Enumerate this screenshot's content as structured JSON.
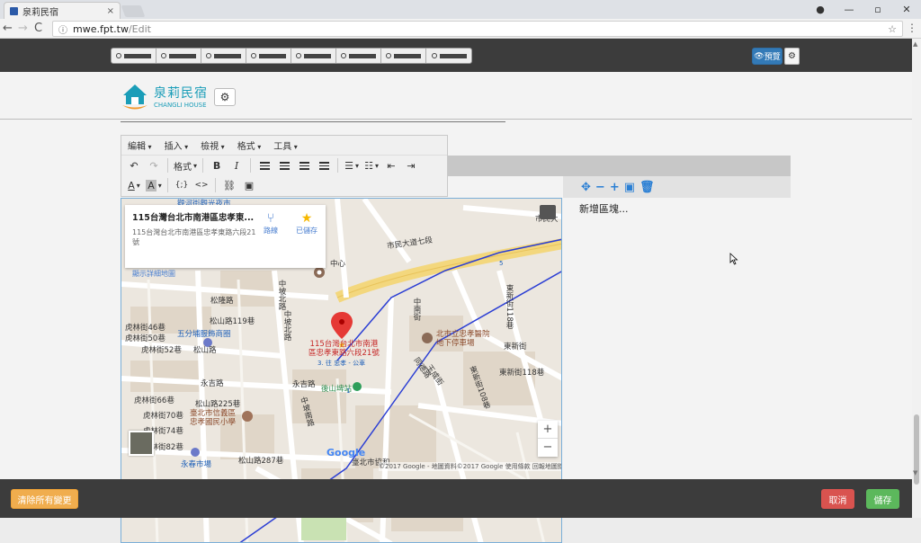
{
  "browser": {
    "tab_title": "泉莉民宿",
    "tab_close": "×",
    "url_host": "mwe.fpt.tw",
    "url_path": "/Edit",
    "nav_back": "←",
    "nav_forward": "→",
    "nav_reload": "C",
    "info_icon": "ⓘ",
    "star_icon": "☆",
    "menu_icon": "⋮",
    "window": {
      "account": "●",
      "minimize": "—",
      "restore": "▫",
      "close": "✕"
    }
  },
  "topbar": {
    "preview_label": "預覽",
    "segment_count": 8
  },
  "logo": {
    "name_cn": "泉莉民宿",
    "name_en": "CHANGLI HOUSE",
    "brand_color": "#1a9db8"
  },
  "editor": {
    "menu": [
      "編輯",
      "插入",
      "檢視",
      "格式",
      "工具"
    ],
    "format_label": "格式",
    "bold": "B",
    "italic": "I",
    "code_block": "{;}",
    "source": "<>",
    "undo": "↶",
    "redo": "↷",
    "font_color": "A",
    "bg_color": "A",
    "link": "⛓",
    "image": "▣"
  },
  "right_panel": {
    "add_block": "新增區塊...",
    "icons": [
      "move-icon",
      "minus-icon",
      "plus-icon",
      "image-icon",
      "trash-icon"
    ]
  },
  "map": {
    "info": {
      "title": "115台灣台北市南港區忠孝東...",
      "address": "115台灣台北市南港區忠孝東路六段21號",
      "route": "路線",
      "saved": "已儲存",
      "more": "顯示詳細地圖"
    },
    "top_label": "觀河街觀光夜市",
    "marker_label_1": "115台灣台北市南港",
    "marker_label_2": "區忠孝東路六段21號",
    "google": "Google",
    "attribution": "©2017 Google - 地圖資料©2017 Google   使用條款   回報地圖錯誤",
    "zoom_in": "+",
    "zoom_out": "−",
    "labels": {
      "songlong": "松隆路",
      "songshan119": "松山路119巷",
      "hulin46": "虎林街46巷",
      "hulin50": "虎林街50巷",
      "hulin52": "虎林街52巷",
      "wufen": "五分埔服飾商圈",
      "songshan": "松山路",
      "yongji": "永吉路",
      "yongji2": "永吉路",
      "hulin66": "虎林街66巷",
      "hulin70": "虎林街70巷",
      "hulin74": "虎林街74巷",
      "hulin82": "虎林街82巷",
      "songshan225": "松山路225巷",
      "xinyi_school": "臺北市信義區\n忠孝國民小學",
      "yongchun_market": "永春市場",
      "songshan287": "松山路287巷",
      "yongchun_station": "後山埤站",
      "shimin7": "市民大道七段",
      "zhongxin": "中心",
      "zhongpo": "中坡北路",
      "zhongpo2": "中坡北路",
      "zhongpo_s": "中坡南路",
      "hospital": "北市立忠孝醫院\n地下停車場",
      "dongxin": "東新街",
      "dongxin118": "東新街118巷",
      "dongxin108": "東新街108巷",
      "tongde": "同德路",
      "zhongnan": "中南街",
      "yucheng": "玉成街",
      "taipei_city": "臺北市協和",
      "road_num_1": "1",
      "road_num_5": "5",
      "shimin_top": "市民大",
      "exit": "3. 往 忠孝 - 公車"
    }
  },
  "bottom": {
    "clear_label": "清除所有變更",
    "cancel_label": "取消",
    "save_label": "儲存",
    "colors": {
      "warn": "#f0ad4e",
      "danger": "#d9534f",
      "success": "#5cb85c"
    }
  }
}
